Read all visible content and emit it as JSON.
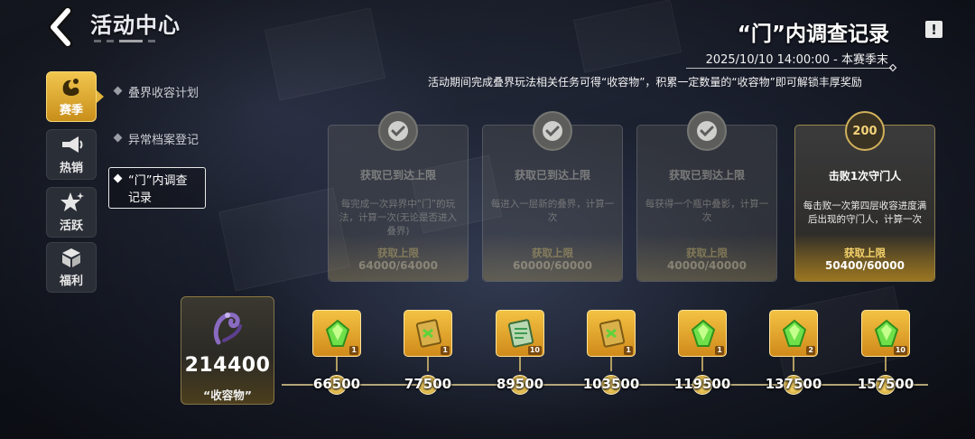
{
  "header": {
    "title": "活动中心",
    "back_icon": "chevron-left-icon"
  },
  "sidebar": {
    "tabs": [
      {
        "label": "赛季",
        "icon": "season-icon",
        "active": true
      },
      {
        "label": "热销",
        "icon": "megaphone-icon",
        "active": false
      },
      {
        "label": "活跃",
        "icon": "star-icon",
        "active": false
      },
      {
        "label": "福利",
        "icon": "gift-box-icon",
        "active": false
      }
    ]
  },
  "subtabs": [
    {
      "label": "叠界收容计划",
      "active": false
    },
    {
      "label": "异常档案登记",
      "active": false
    },
    {
      "label": "“门”内调查记录",
      "active": true
    }
  ],
  "page": {
    "title": "“门”内调查记录",
    "date": "2025/10/10 14:00:00 - 本赛季末",
    "description": "活动期间完成叠界玩法相关任务可得“收容物”，积累一定数量的“收容物”即可解锁丰厚奖励",
    "info_icon": "exclamation-icon"
  },
  "cards": [
    {
      "status": "done",
      "title": "获取已到达上限",
      "desc": "每完成一次异界中“门”的玩法，计算一次(无论是否进入叠界)",
      "limit_label": "获取上限",
      "limit_value": "64000/64000"
    },
    {
      "status": "done",
      "title": "获取已到达上限",
      "desc": "每进入一层新的叠界，计算一次",
      "limit_label": "获取上限",
      "limit_value": "60000/60000"
    },
    {
      "status": "done",
      "title": "获取已到达上限",
      "desc": "每获得一个瓶中叠影，计算一次",
      "limit_label": "获取上限",
      "limit_value": "40000/40000"
    },
    {
      "status": "active",
      "badge": "200",
      "title": "击败1次守门人",
      "desc": "每击败一次第四层收容进度满后出现的守门人，计算一次",
      "limit_label": "获取上限",
      "limit_value": "50400/60000"
    }
  ],
  "currency": {
    "value": "214400",
    "name": "“收容物”"
  },
  "milestones": [
    {
      "value": "66500",
      "reward_icon": "green-crystal-icon",
      "count": "1"
    },
    {
      "value": "77500",
      "reward_icon": "golden-scroll-icon",
      "count": "1"
    },
    {
      "value": "89500",
      "reward_icon": "green-scroll-icon",
      "count": "10"
    },
    {
      "value": "103500",
      "reward_icon": "golden-scroll-icon",
      "count": "1"
    },
    {
      "value": "119500",
      "reward_icon": "green-crystal-icon",
      "count": "1"
    },
    {
      "value": "137500",
      "reward_icon": "green-crystal-icon",
      "count": "2"
    },
    {
      "value": "157500",
      "reward_icon": "green-crystal-icon",
      "count": "10"
    }
  ]
}
